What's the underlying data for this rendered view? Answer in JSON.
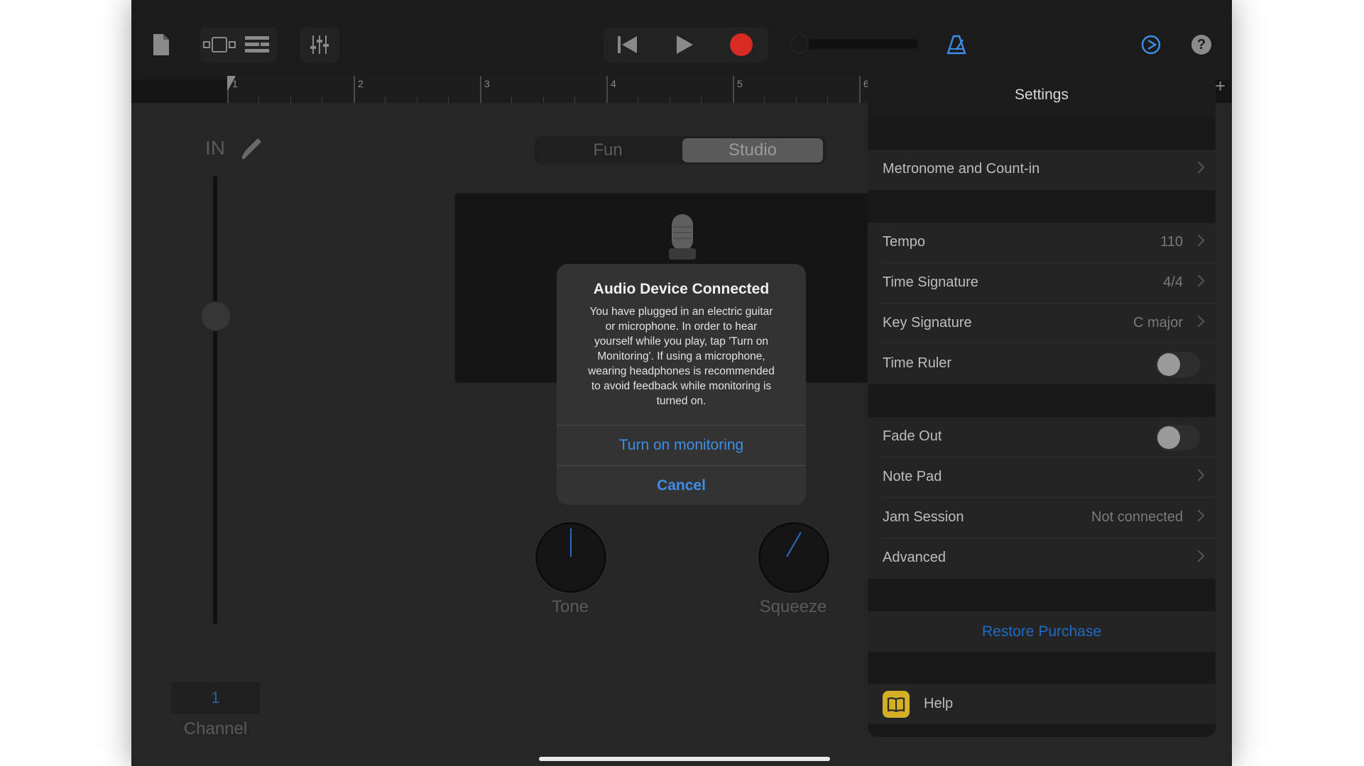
{
  "toolbar": {
    "icons": [
      "document-icon",
      "tracks-view-icon",
      "list-view-icon",
      "mixer-icon",
      "rewind-icon",
      "play-icon",
      "record-icon",
      "metronome-icon",
      "settings-icon",
      "help-icon"
    ],
    "record_color": "#d62a22",
    "accent_color": "#3d8ee8"
  },
  "ruler": {
    "bars": [
      "1",
      "2",
      "3",
      "4",
      "5",
      "6"
    ]
  },
  "instrument": {
    "input_label": "IN",
    "modes": [
      "Fun",
      "Studio"
    ],
    "selected_mode": "Studio",
    "knobs": [
      {
        "label": "Tone",
        "level": 0.5
      },
      {
        "label": "Squeeze",
        "level": 0.6
      }
    ],
    "channel_value": "1",
    "channel_label": "Channel"
  },
  "modal": {
    "title": "Audio Device Connected",
    "message_lines": [
      "You have plugged in an electric guitar",
      "or microphone. In order to hear",
      "yourself while you play, tap 'Turn on",
      "Monitoring'. If using a microphone,",
      "wearing headphones is recommended",
      "to avoid feedback while monitoring is",
      "turned on."
    ],
    "primary_button": "Turn on monitoring",
    "cancel_button": "Cancel"
  },
  "settings": {
    "title": "Settings",
    "add_glyph": "+",
    "group1": [
      {
        "label": "Metronome and Count-in",
        "value": ""
      }
    ],
    "group2": [
      {
        "label": "Tempo",
        "value": "110"
      },
      {
        "label": "Time Signature",
        "value": "4/4"
      },
      {
        "label": "Key Signature",
        "value": "C major"
      },
      {
        "label": "Time Ruler",
        "toggle": false
      }
    ],
    "group3": [
      {
        "label": "Fade Out",
        "toggle": false
      },
      {
        "label": "Note Pad",
        "value": ""
      },
      {
        "label": "Jam Session",
        "value": "Not connected"
      },
      {
        "label": "Advanced",
        "value": ""
      }
    ],
    "restore_label": "Restore Purchase",
    "help_label": "Help",
    "help_icon_color": "#d4b025"
  }
}
